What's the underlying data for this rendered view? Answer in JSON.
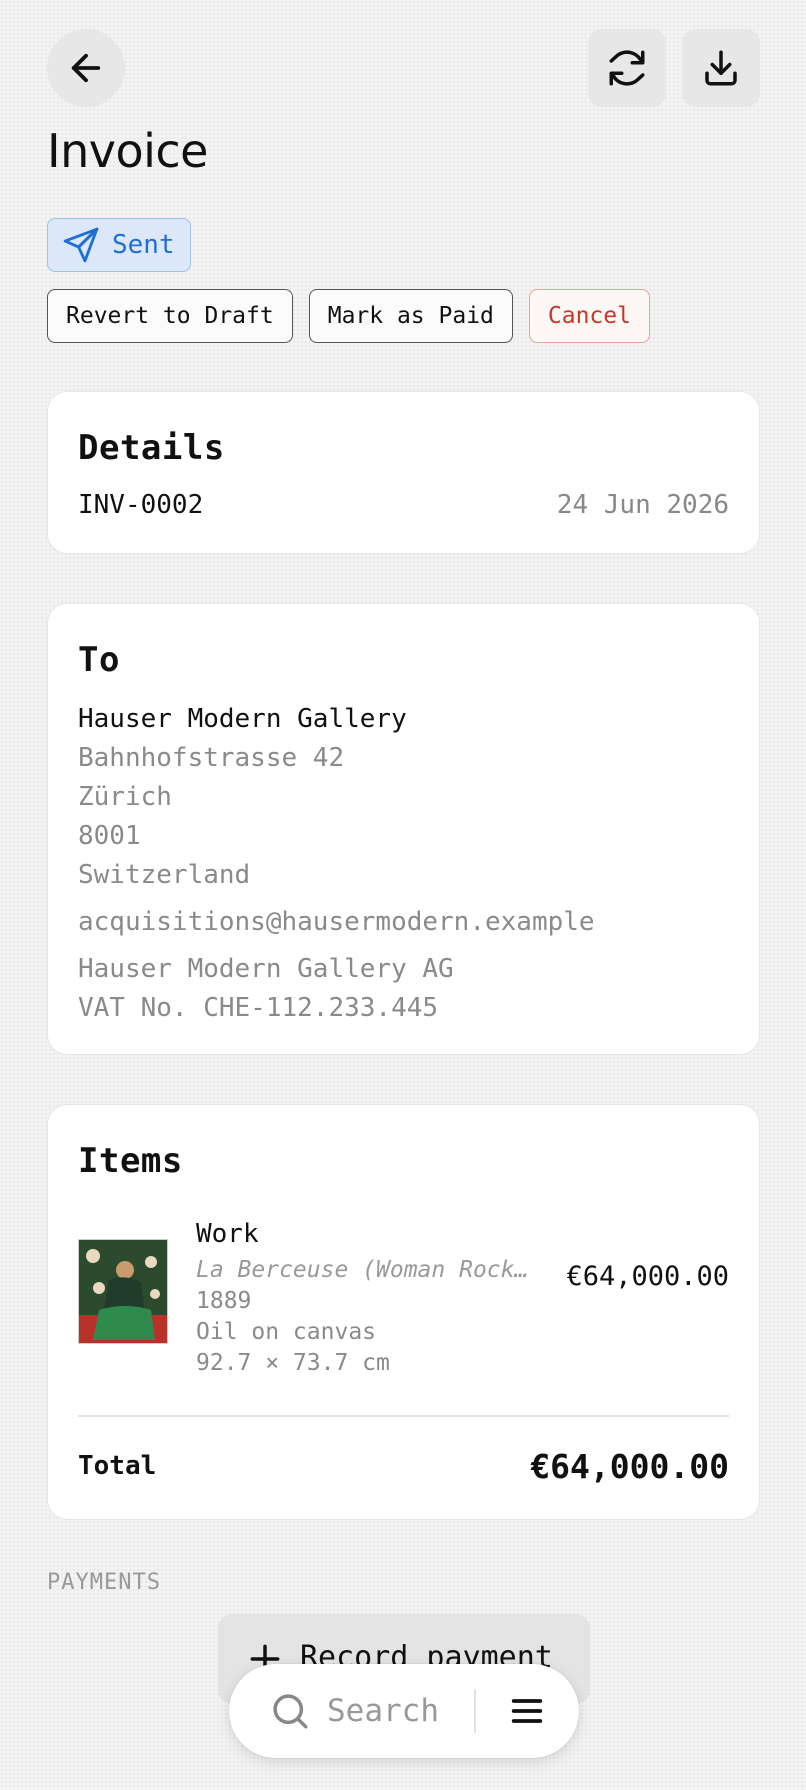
{
  "header": {
    "title": "Invoice",
    "back_icon": "arrow-left-icon",
    "refresh_icon": "refresh-icon",
    "download_icon": "download-icon"
  },
  "status": {
    "label": "Sent",
    "icon": "send-icon",
    "color": "#1f6fd6"
  },
  "actions": {
    "revert": "Revert to Draft",
    "mark_paid": "Mark as Paid",
    "cancel": "Cancel"
  },
  "details": {
    "heading": "Details",
    "number": "INV-0002",
    "date": "24 Jun 2026"
  },
  "recipient": {
    "heading": "To",
    "name": "Hauser Modern Gallery",
    "street": "Bahnhofstrasse 42",
    "city": "Zürich",
    "postcode": "8001",
    "country": "Switzerland",
    "email": "acquisitions@hausermodern.example",
    "company": "Hauser Modern Gallery AG",
    "vat": "VAT No. CHE-112.233.445"
  },
  "items": {
    "heading": "Items",
    "list": [
      {
        "label": "Work",
        "title": "La Berceuse (Woman Rock…",
        "year": "1889",
        "medium": "Oil on canvas",
        "dimensions": "92.7 × 73.7 cm",
        "price": "€64,000.00"
      }
    ],
    "total_label": "Total",
    "total_amount": "€64,000.00"
  },
  "payments": {
    "heading": "PAYMENTS",
    "record_label": "Record payment"
  },
  "bottom_bar": {
    "search_label": "Search",
    "search_icon": "search-icon",
    "menu_icon": "menu-icon"
  }
}
